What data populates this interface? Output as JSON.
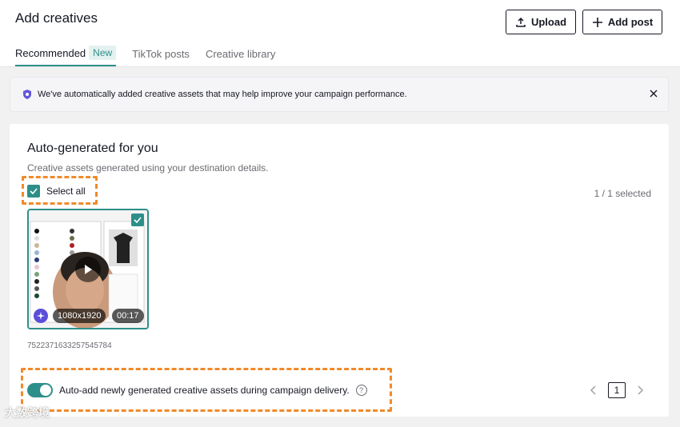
{
  "header": {
    "title": "Add creatives",
    "upload_label": "Upload",
    "add_post_label": "Add post"
  },
  "tabs": [
    {
      "label": "Recommended",
      "badge": "New",
      "active": true
    },
    {
      "label": "TikTok posts",
      "active": false
    },
    {
      "label": "Creative library",
      "active": false
    }
  ],
  "banner": {
    "text": "We've automatically added creative assets that may help improve your campaign performance."
  },
  "card": {
    "title": "Auto-generated for you",
    "subtitle": "Creative assets generated using your destination details.",
    "select_all_label": "Select all",
    "selected_count": "1 / 1 selected"
  },
  "asset": {
    "resolution": "1080x1920",
    "duration": "00:17",
    "id": "7522371633257545784",
    "selected": true
  },
  "auto_add": {
    "label": "Auto-add newly generated creative assets during campaign delivery.",
    "enabled": true
  },
  "pager": {
    "current": "1"
  },
  "watermark": "大数跨境",
  "colors": {
    "accent": "#2d8f89",
    "highlight": "#f08a2a"
  }
}
